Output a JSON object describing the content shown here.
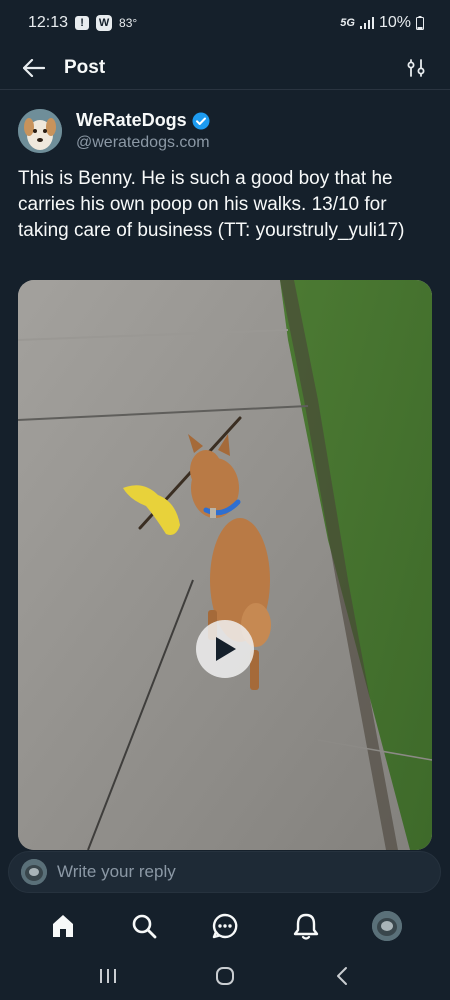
{
  "status_bar": {
    "time": "12:13",
    "alert_glyph": "!",
    "weather_glyph": "W",
    "temperature": "83°",
    "network": "5G",
    "battery": "10%"
  },
  "header": {
    "title": "Post",
    "back_icon": "arrow-left-icon",
    "settings_icon": "sliders-icon"
  },
  "tweet": {
    "author_name": "WeRateDogs",
    "author_handle": "@weratedogs.com",
    "verified": true,
    "text": "This is Benny. He is such a good boy that he carries his own poop on his walks. 13/10 for taking care of business (TT: yourstruly_yuli17)",
    "media_type": "video"
  },
  "reply": {
    "placeholder": "Write your reply"
  },
  "bottom_nav": [
    "home-icon",
    "search-icon",
    "messages-icon",
    "notifications-icon",
    "profile-avatar"
  ],
  "system_nav": [
    "recent-apps-icon",
    "home-circle-icon",
    "back-chevron-icon"
  ],
  "colors": {
    "background": "#15202b",
    "accent": "#1d9bf0",
    "text_primary": "#f7f9f9",
    "text_secondary": "#8b98a5"
  }
}
